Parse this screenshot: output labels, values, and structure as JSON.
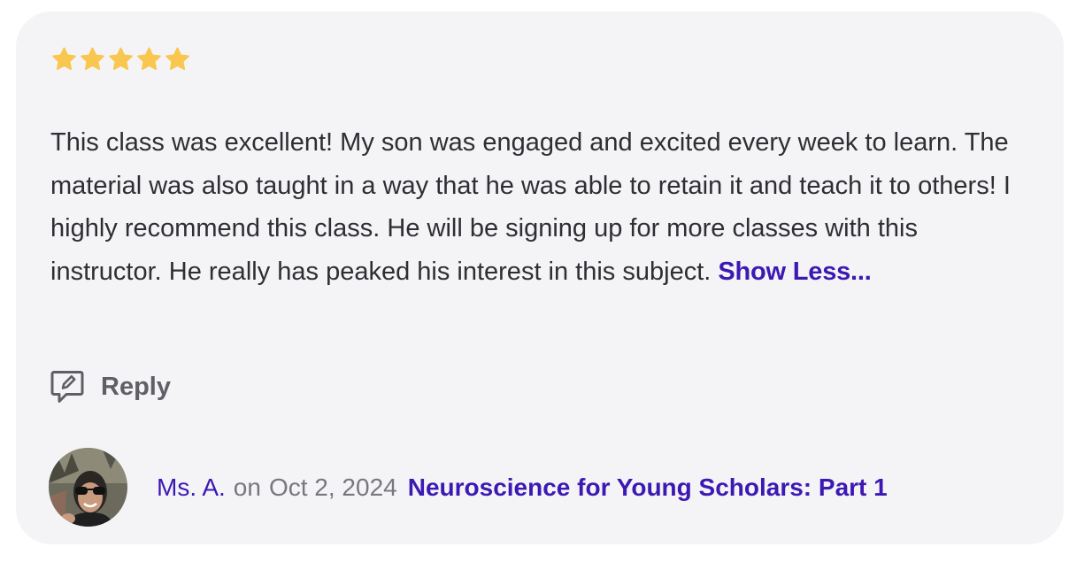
{
  "review": {
    "rating": 5,
    "rating_max": 5,
    "star_color": "#f9c74f",
    "text": "This class was excellent!  My son was engaged and excited every week to learn.  The material was also taught in a way that he was able to retain it and teach it to others!  I highly recommend this class.  He will be signing up for more classes with this instructor.  He really has peaked his interest in this subject.",
    "toggle_label": "Show Less..."
  },
  "reply": {
    "icon": "reply-edit-icon",
    "label": "Reply"
  },
  "author": {
    "name": "Ms. A.",
    "on_label": "on",
    "date": "Oct 2, 2024",
    "class_title": "Neuroscience for Young Scholars: Part 1"
  },
  "colors": {
    "card_background": "#f4f4f7",
    "link": "#3d19b3",
    "text": "#2e2e33",
    "muted": "#77777e"
  }
}
